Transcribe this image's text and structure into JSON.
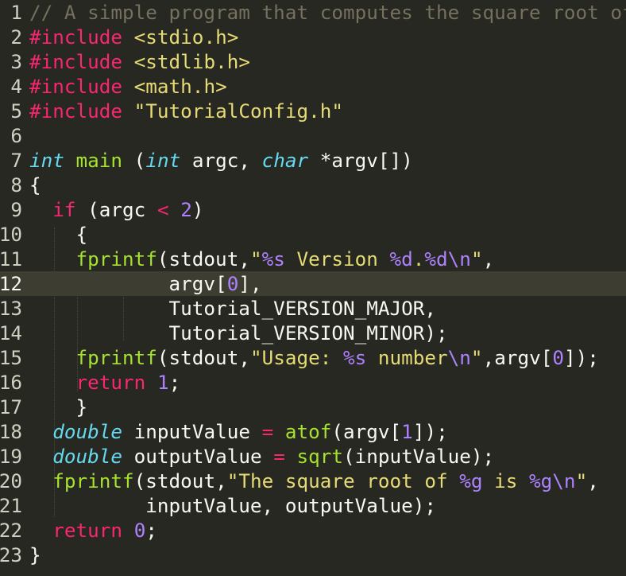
{
  "editor": {
    "theme_colors": {
      "background": "#272822",
      "keyword": "#f92672",
      "type": "#66d9ef",
      "function": "#a6e22e",
      "string": "#e6db74",
      "number": "#ae81ff",
      "comment": "#75715e",
      "text": "#f8f8f2"
    },
    "active_line": 12,
    "lines": [
      {
        "num": "1",
        "tokens": [
          {
            "t": "c",
            "v": "// A simple program that computes the square root of a number"
          }
        ]
      },
      {
        "num": "2",
        "tokens": [
          {
            "t": "k",
            "v": "#include"
          },
          {
            "t": "p",
            "v": " "
          },
          {
            "t": "s",
            "v": "<stdio.h>"
          }
        ]
      },
      {
        "num": "3",
        "tokens": [
          {
            "t": "k",
            "v": "#include"
          },
          {
            "t": "p",
            "v": " "
          },
          {
            "t": "s",
            "v": "<stdlib.h>"
          }
        ]
      },
      {
        "num": "4",
        "tokens": [
          {
            "t": "k",
            "v": "#include"
          },
          {
            "t": "p",
            "v": " "
          },
          {
            "t": "s",
            "v": "<math.h>"
          }
        ]
      },
      {
        "num": "5",
        "tokens": [
          {
            "t": "k",
            "v": "#include"
          },
          {
            "t": "p",
            "v": " "
          },
          {
            "t": "s",
            "v": "\"TutorialConfig.h\""
          }
        ]
      },
      {
        "num": "6",
        "tokens": []
      },
      {
        "num": "7",
        "tokens": [
          {
            "t": "t",
            "v": "int"
          },
          {
            "t": "p",
            "v": " "
          },
          {
            "t": "f",
            "v": "main"
          },
          {
            "t": "p",
            "v": " ("
          },
          {
            "t": "t",
            "v": "int"
          },
          {
            "t": "p",
            "v": " argc, "
          },
          {
            "t": "t",
            "v": "char"
          },
          {
            "t": "p",
            "v": " *argv[])"
          }
        ]
      },
      {
        "num": "8",
        "tokens": [
          {
            "t": "p",
            "v": "{"
          }
        ]
      },
      {
        "num": "9",
        "tokens": [
          {
            "t": "p",
            "v": "  "
          },
          {
            "t": "k",
            "v": "if"
          },
          {
            "t": "p",
            "v": " (argc "
          },
          {
            "t": "k",
            "v": "<"
          },
          {
            "t": "p",
            "v": " "
          },
          {
            "t": "n",
            "v": "2"
          },
          {
            "t": "p",
            "v": ")"
          }
        ]
      },
      {
        "num": "10",
        "tokens": [
          {
            "t": "p",
            "v": "    {"
          }
        ]
      },
      {
        "num": "11",
        "tokens": [
          {
            "t": "p",
            "v": "    "
          },
          {
            "t": "f",
            "v": "fprintf"
          },
          {
            "t": "p",
            "v": "(stdout,"
          },
          {
            "t": "s",
            "v": "\""
          },
          {
            "t": "n",
            "v": "%s"
          },
          {
            "t": "s",
            "v": " Version "
          },
          {
            "t": "n",
            "v": "%d"
          },
          {
            "t": "s",
            "v": "."
          },
          {
            "t": "n",
            "v": "%d\\n"
          },
          {
            "t": "s",
            "v": "\""
          },
          {
            "t": "p",
            "v": ","
          }
        ]
      },
      {
        "num": "12",
        "tokens": [
          {
            "t": "p",
            "v": "            argv["
          },
          {
            "t": "n",
            "v": "0"
          },
          {
            "t": "p",
            "v": "],"
          }
        ]
      },
      {
        "num": "13",
        "tokens": [
          {
            "t": "p",
            "v": "            Tutorial_VERSION_MAJOR,"
          }
        ]
      },
      {
        "num": "14",
        "tokens": [
          {
            "t": "p",
            "v": "            Tutorial_VERSION_MINOR);"
          }
        ]
      },
      {
        "num": "15",
        "tokens": [
          {
            "t": "p",
            "v": "    "
          },
          {
            "t": "f",
            "v": "fprintf"
          },
          {
            "t": "p",
            "v": "(stdout,"
          },
          {
            "t": "s",
            "v": "\"Usage: "
          },
          {
            "t": "n",
            "v": "%s"
          },
          {
            "t": "s",
            "v": " number"
          },
          {
            "t": "n",
            "v": "\\n"
          },
          {
            "t": "s",
            "v": "\""
          },
          {
            "t": "p",
            "v": ",argv["
          },
          {
            "t": "n",
            "v": "0"
          },
          {
            "t": "p",
            "v": "]);"
          }
        ]
      },
      {
        "num": "16",
        "tokens": [
          {
            "t": "p",
            "v": "    "
          },
          {
            "t": "k",
            "v": "return"
          },
          {
            "t": "p",
            "v": " "
          },
          {
            "t": "n",
            "v": "1"
          },
          {
            "t": "p",
            "v": ";"
          }
        ]
      },
      {
        "num": "17",
        "tokens": [
          {
            "t": "p",
            "v": "    }"
          }
        ]
      },
      {
        "num": "18",
        "tokens": [
          {
            "t": "p",
            "v": "  "
          },
          {
            "t": "t",
            "v": "double"
          },
          {
            "t": "p",
            "v": " inputValue "
          },
          {
            "t": "k",
            "v": "="
          },
          {
            "t": "p",
            "v": " "
          },
          {
            "t": "f",
            "v": "atof"
          },
          {
            "t": "p",
            "v": "(argv["
          },
          {
            "t": "n",
            "v": "1"
          },
          {
            "t": "p",
            "v": "]);"
          }
        ]
      },
      {
        "num": "19",
        "tokens": [
          {
            "t": "p",
            "v": "  "
          },
          {
            "t": "t",
            "v": "double"
          },
          {
            "t": "p",
            "v": " outputValue "
          },
          {
            "t": "k",
            "v": "="
          },
          {
            "t": "p",
            "v": " "
          },
          {
            "t": "f",
            "v": "sqrt"
          },
          {
            "t": "p",
            "v": "(inputValue);"
          }
        ]
      },
      {
        "num": "20",
        "tokens": [
          {
            "t": "p",
            "v": "  "
          },
          {
            "t": "f",
            "v": "fprintf"
          },
          {
            "t": "p",
            "v": "(stdout,"
          },
          {
            "t": "s",
            "v": "\"The square root of "
          },
          {
            "t": "n",
            "v": "%g"
          },
          {
            "t": "s",
            "v": " is "
          },
          {
            "t": "n",
            "v": "%g\\n"
          },
          {
            "t": "s",
            "v": "\""
          },
          {
            "t": "p",
            "v": ","
          }
        ]
      },
      {
        "num": "21",
        "tokens": [
          {
            "t": "p",
            "v": "          inputValue, outputValue);"
          }
        ]
      },
      {
        "num": "22",
        "tokens": [
          {
            "t": "p",
            "v": "  "
          },
          {
            "t": "k",
            "v": "return"
          },
          {
            "t": "p",
            "v": " "
          },
          {
            "t": "n",
            "v": "0"
          },
          {
            "t": "p",
            "v": ";"
          }
        ]
      },
      {
        "num": "23",
        "tokens": [
          {
            "t": "p",
            "v": "}"
          }
        ]
      }
    ]
  }
}
